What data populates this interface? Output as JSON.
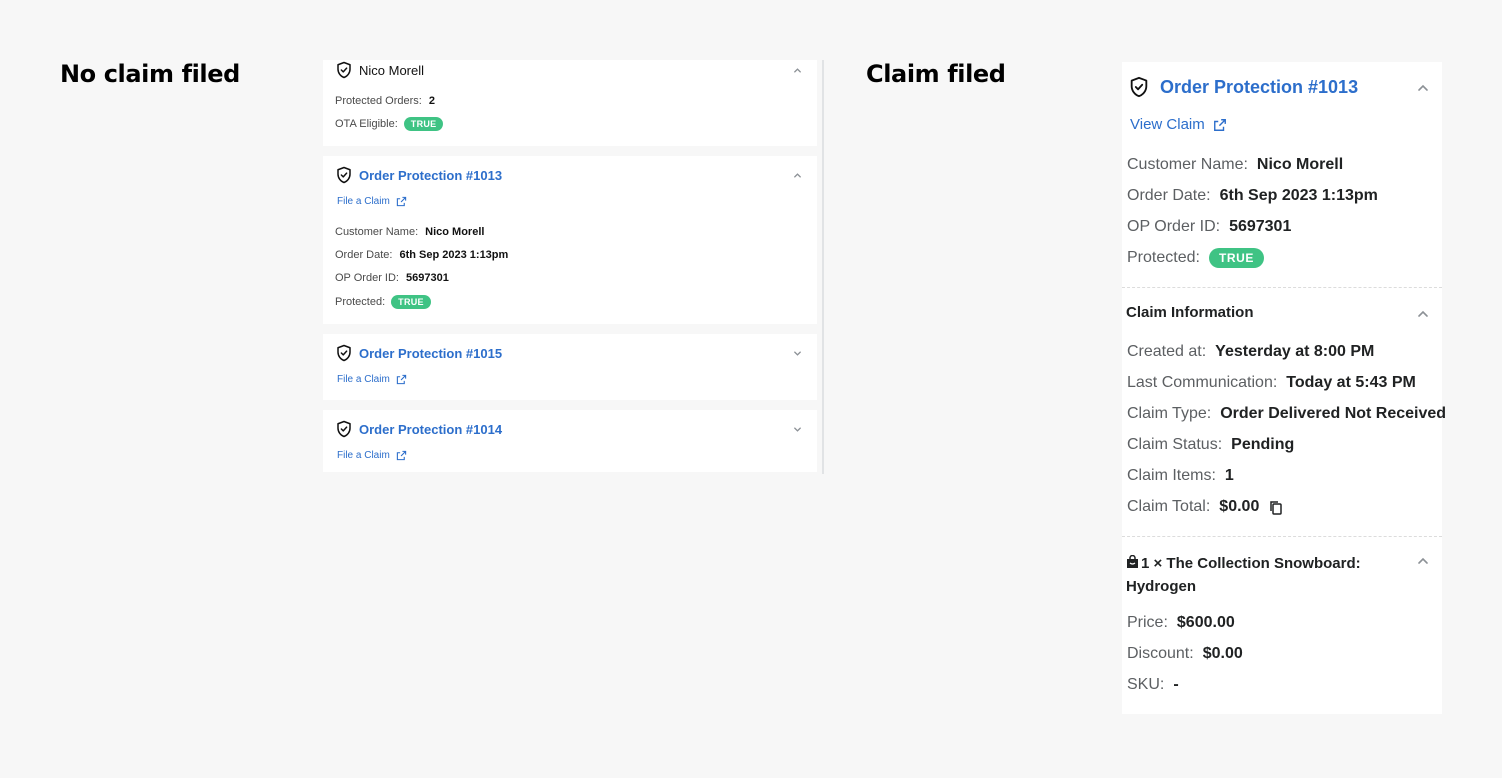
{
  "sections": {
    "left_title": "No claim filed",
    "right_title": "Claim filed"
  },
  "left": {
    "customer_card": {
      "name": "Nico Morell",
      "rows": [
        {
          "label": "Protected Orders:",
          "value": "2"
        },
        {
          "label": "OTA Eligible:",
          "badge": "TRUE"
        }
      ]
    },
    "orders": [
      {
        "title": "Order Protection #1013",
        "link": "File a Claim",
        "expanded": true,
        "rows": [
          {
            "label": "Customer Name:",
            "value": "Nico Morell"
          },
          {
            "label": "Order Date:",
            "value": "6th Sep 2023 1:13pm"
          },
          {
            "label": "OP Order ID:",
            "value": "5697301"
          },
          {
            "label": "Protected:",
            "badge": "TRUE"
          }
        ]
      },
      {
        "title": "Order Protection #1015",
        "link": "File a Claim",
        "expanded": false
      },
      {
        "title": "Order Protection #1014",
        "link": "File a Claim",
        "expanded": false
      }
    ]
  },
  "right": {
    "title": "Order Protection #1013",
    "link": "View Claim",
    "order_rows": [
      {
        "label": "Customer Name:",
        "value": "Nico Morell"
      },
      {
        "label": "Order Date:",
        "value": "6th Sep 2023 1:13pm"
      },
      {
        "label": "OP Order ID:",
        "value": "5697301"
      },
      {
        "label": "Protected:",
        "badge": "TRUE"
      }
    ],
    "claim_section_title": "Claim Information",
    "claim_rows": [
      {
        "label": "Created at:",
        "value": "Yesterday at 8:00 PM"
      },
      {
        "label": "Last Communication:",
        "value": "Today at 5:43 PM"
      },
      {
        "label": "Claim Type:",
        "value": "Order Delivered Not Received"
      },
      {
        "label": "Claim Status:",
        "value": "Pending"
      },
      {
        "label": "Claim Items:",
        "value": "1"
      },
      {
        "label": "Claim Total:",
        "value": "$0.00"
      }
    ],
    "item_title": "1 × The Collection Snowboard: Hydrogen",
    "item_rows": [
      {
        "label": "Price:",
        "value": "$600.00"
      },
      {
        "label": "Discount:",
        "value": "$0.00"
      },
      {
        "label": "SKU:",
        "value": "-"
      }
    ]
  },
  "colors": {
    "link": "#2c6ecb",
    "badge": "#3fc384",
    "background": "#f7f7f7"
  },
  "icons": [
    "shield-check-icon",
    "chevron-up-icon",
    "chevron-down-icon",
    "external-link-icon",
    "copy-icon",
    "shopping-bag-icon"
  ]
}
